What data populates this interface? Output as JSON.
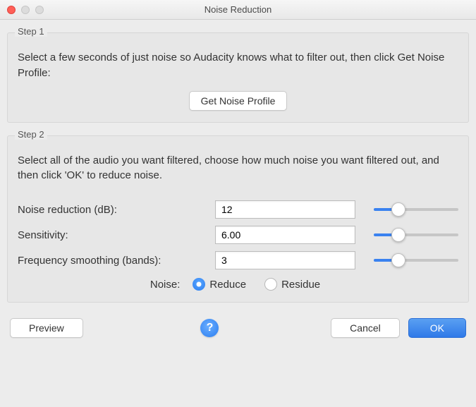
{
  "window": {
    "title": "Noise Reduction"
  },
  "step1": {
    "label": "Step 1",
    "text": "Select a few seconds of just noise so Audacity knows what to filter out, then click Get Noise Profile:",
    "button": "Get Noise Profile"
  },
  "step2": {
    "label": "Step 2",
    "text": "Select all of the audio you want filtered, choose how much noise you want filtered out, and then click 'OK' to reduce noise.",
    "params": {
      "reduction": {
        "label": "Noise reduction (dB):",
        "value": "12",
        "min": 0,
        "max": 48,
        "slider": 12
      },
      "sensitivity": {
        "label": "Sensitivity:",
        "value": "6.00",
        "min": 0,
        "max": 24,
        "slider": 6
      },
      "smoothing": {
        "label": "Frequency smoothing (bands):",
        "value": "3",
        "min": 0,
        "max": 12,
        "slider": 3
      }
    },
    "noise_label": "Noise:",
    "radio": {
      "reduce": "Reduce",
      "residue": "Residue",
      "selected": "reduce"
    }
  },
  "footer": {
    "preview": "Preview",
    "help": "?",
    "cancel": "Cancel",
    "ok": "OK"
  },
  "colors": {
    "accent": "#2f79e8",
    "slider_fill": "#3a82f0",
    "slider_track": "#c6c6c6"
  }
}
